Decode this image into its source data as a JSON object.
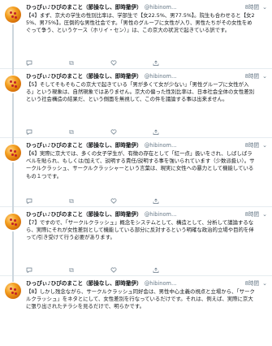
{
  "tweets": [
    {
      "name": "ひっぴぃ♪ひびのまこと（節操なし、即時撤伊）",
      "handle": "@hibinom…",
      "time": "8時間",
      "text": "【4】まず、京大の学生の性別比率は、学部生で【女22.5%、男77.5%】。院生も合わせると【女25%、男75%】。圧倒的な男性社会です。「男性のグループに女性が入り、男性たちがその女性をめぐって争う、というケース（ホリイ・セン）」は、この京大の状況で起きている訳です。"
    },
    {
      "name": "ひっぴぃ♪ひびのまこと（節操なし、即時撤伊）",
      "handle": "@hibinom…",
      "time": "8時間",
      "text": "【5】そしてそもそもこの京大で起きている「男が多くて女が少ない」「男性グループに女性が入る」という現象は、自然現象ではありません。京大の偏った性別比率は、日本社会全体の女性差別という社会構造の結果だ、という側面を無視して、この件を議論する事は出来ません。"
    },
    {
      "name": "ひっぴぃ♪ひびのまこと（節操なし、即時撤伊）",
      "handle": "@hibinom…",
      "time": "8時間",
      "text": "【6】実際に京大では、多くの女子学生が、有徴の存在として「紅一点」扱いをされ、しばしばラベルを貼られ、もしくは/加えて、説明する責任/説明する事を強いられています（少数派扱い）。サークルクラッシュ、サークルクラッシャーという言葉は、現実に女性への暴力として機能しているもの１つです。"
    },
    {
      "name": "ひっぴぃ♪ひびのまこと（節操なし、即時撤伊）",
      "handle": "@hibinom…",
      "time": "8時間",
      "text": "【7】ですので、「サークルクラッシュ」概念をシステムとして、構造として、分析して議論するなら、実際にそれが女性差別として機能している部分に反対するという明確な政治的立場や目的を伴って/引き受けて行う必要があります。"
    },
    {
      "name": "ひっぴぃ♪ひびのまこと（節操なし、即時撤伊）",
      "handle": "@hibinom…",
      "time": "8時間",
      "text": "【8】しかし残念ながら、サークルクラッシュ同好会は、男性中心主義の視点と立場から、「サークルクラッシュ」をネタとにして、女性差別を行なっているだけです。それは、例えば、実際に京大に張り出されたチラシを見るだけで、明らかです。"
    }
  ]
}
